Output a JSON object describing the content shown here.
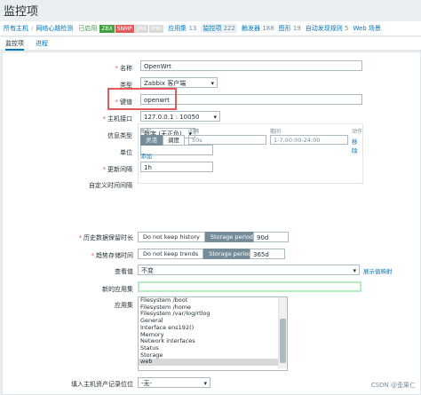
{
  "page": {
    "title": "监控项"
  },
  "breadcrumb": {
    "all_hosts": "所有主机",
    "sep": "/",
    "host": "网络心跳检测",
    "status": "已启用",
    "badges": [
      "ZBX",
      "SNMP",
      "JMX",
      "IPMI"
    ],
    "sections": [
      {
        "label": "应用集",
        "count": "13"
      },
      {
        "label": "监控项",
        "count": "222",
        "active": true
      },
      {
        "label": "触发器",
        "count": "188"
      },
      {
        "label": "图形",
        "count": "19"
      },
      {
        "label": "自动发现规则",
        "count": "5"
      },
      {
        "label": "Web 场景",
        "count": ""
      }
    ]
  },
  "tabs": [
    "监控项",
    "进程"
  ],
  "form": {
    "name": {
      "label": "名称",
      "value": "OpenWrt"
    },
    "type": {
      "label": "类型",
      "value": "Zabbix 客户端"
    },
    "key": {
      "label": "键值",
      "value": "openwrt"
    },
    "interface": {
      "label": "主机接口",
      "value": "127.0.0.1 : 10050"
    },
    "info_type": {
      "label": "信息类型",
      "value": "数字 (无正负)"
    },
    "units": {
      "label": "单位",
      "value": ""
    },
    "delay": {
      "label": "更新间隔",
      "value": "1h"
    },
    "custom_intervals": {
      "label": "自定义时间间隔",
      "headers": {
        "type": "类型",
        "interval": "间隔",
        "period": "期间",
        "action": "动作"
      },
      "types": [
        "灵活",
        "调度"
      ],
      "interval_placeholder": "50s",
      "period_placeholder": "1-7,00:00-24:00",
      "remove": "移除",
      "add": "添加"
    },
    "history": {
      "label": "历史数据保留时长",
      "options": [
        "Do not keep history",
        "Storage period"
      ],
      "value": "90d"
    },
    "trends": {
      "label": "趋势存储时间",
      "options": [
        "Do not keep trends",
        "Storage period"
      ],
      "value": "365d"
    },
    "valuemap": {
      "label": "查看值",
      "value": "不变",
      "link": "展示值映射"
    },
    "new_app": {
      "label": "新的应用集",
      "value": ""
    },
    "apps": {
      "label": "应用集",
      "items": [
        "Filesystem /boot",
        "Filesystem /home",
        "Filesystem /var/log/rtlog",
        "General",
        "Interface ens192()",
        "Memory",
        "Network interfaces",
        "Status",
        "Storage",
        "web"
      ],
      "selected": "web"
    },
    "inventory": {
      "label": "填入主机资产记录位位",
      "value": "-无-"
    }
  },
  "watermark": "CSDN @歪果仁"
}
